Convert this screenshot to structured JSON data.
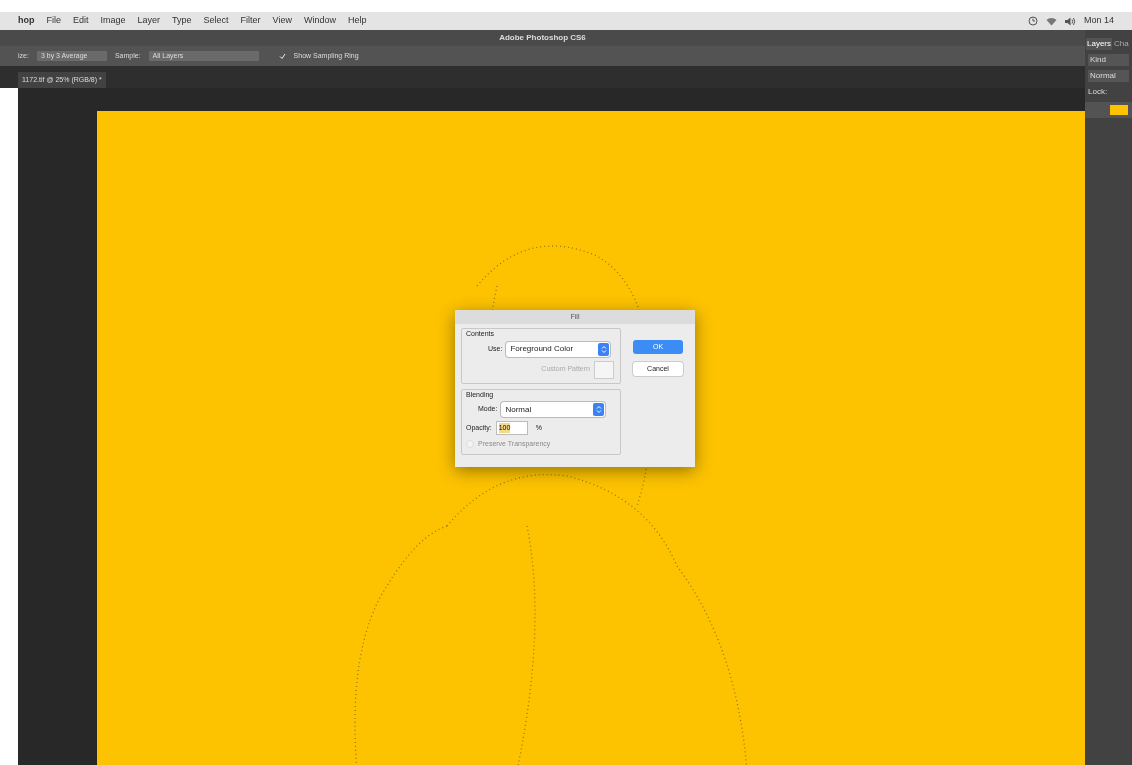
{
  "menu_bar": {
    "app": "hop",
    "items": [
      "File",
      "Edit",
      "Image",
      "Layer",
      "Type",
      "Select",
      "Filter",
      "View",
      "Window",
      "Help"
    ],
    "clock": "Mon 14"
  },
  "window": {
    "title": "Adobe Photoshop CS6"
  },
  "options_bar": {
    "size_label": "ize:",
    "size_value": "3 by 3 Average",
    "sample_label": "Sample:",
    "sample_value": "All Layers",
    "sampling_ring": {
      "label": "Show Sampling Ring",
      "checked": true
    }
  },
  "document_tab": {
    "title": "1172.tif @ 25% (RGB/8) *"
  },
  "layers_panel": {
    "tabs": [
      {
        "label": "Layers",
        "selected": true
      },
      {
        "label": "Cha",
        "selected": false
      }
    ],
    "filter": "Kind",
    "blend_mode": "Normal",
    "lock_label": "Lock:"
  },
  "fill_dialog": {
    "title": "Fill",
    "contents": {
      "legend": "Contents",
      "use_label": "Use:",
      "use_value": "Foreground Color",
      "pattern_label": "Custom Pattern",
      "pattern_disabled": true
    },
    "blending": {
      "legend": "Blending",
      "mode_label": "Mode:",
      "mode_value": "Normal",
      "opacity_label": "Opacity:",
      "opacity_value": "100",
      "opacity_unit": "%",
      "preserve": {
        "label": "Preserve Transparency",
        "checked": false,
        "disabled": true
      }
    },
    "buttons": [
      {
        "label": "OK",
        "default": true
      },
      {
        "label": "Cancel",
        "default": false
      }
    ]
  }
}
